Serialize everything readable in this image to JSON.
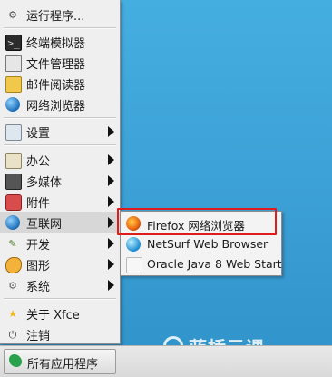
{
  "menu": {
    "run": "运行程序...",
    "items": [
      {
        "label": "终端模拟器",
        "icon": "terminal-icon"
      },
      {
        "label": "文件管理器",
        "icon": "folder-icon"
      },
      {
        "label": "邮件阅读器",
        "icon": "mail-icon"
      },
      {
        "label": "网络浏览器",
        "icon": "web-browser-icon"
      }
    ],
    "settings": "设置",
    "categories": [
      {
        "label": "办公",
        "icon": "office-icon"
      },
      {
        "label": "多媒体",
        "icon": "multimedia-icon"
      },
      {
        "label": "附件",
        "icon": "accessories-icon"
      },
      {
        "label": "互联网",
        "icon": "internet-icon"
      },
      {
        "label": "开发",
        "icon": "development-icon"
      },
      {
        "label": "图形",
        "icon": "graphics-icon"
      },
      {
        "label": "系统",
        "icon": "system-icon"
      }
    ],
    "about": "关于 Xfce",
    "logout": "注销"
  },
  "submenu": {
    "items": [
      {
        "label": "Firefox 网络浏览器",
        "icon": "firefox-icon"
      },
      {
        "label": "NetSurf Web Browser",
        "icon": "netsurf-icon"
      },
      {
        "label": "Oracle Java 8 Web Start",
        "icon": "java-icon"
      }
    ]
  },
  "taskbar": {
    "start_label": "所有应用程序"
  },
  "watermark": "蓝桥云课",
  "colors": {
    "highlight": "#e01b1b",
    "desktop": "#3aa2d6"
  }
}
